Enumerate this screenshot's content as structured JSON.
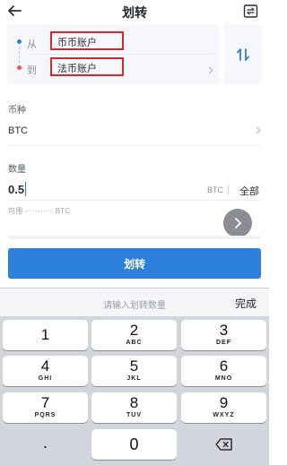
{
  "header": {
    "title": "划转",
    "back_icon": "arrow-left-icon",
    "record_icon": "transfer-record-icon"
  },
  "transfer": {
    "from_label": "从",
    "from_account": "币币账户",
    "to_label": "到",
    "to_account": "法币账户",
    "swap_icon": "swap-arrows-icon"
  },
  "coin": {
    "label": "币种",
    "value": "BTC"
  },
  "amount": {
    "label": "数量",
    "value": "0.5",
    "unit": "BTC",
    "all_label": "全部",
    "available_text": "可用 ··········· BTC"
  },
  "next_icon": "chevron-right-icon",
  "submit_label": "划转",
  "keyboard": {
    "placeholder": "请输入划转数量",
    "done_label": "完成",
    "keys": [
      {
        "num": "1",
        "letters": ""
      },
      {
        "num": "2",
        "letters": "ABC"
      },
      {
        "num": "3",
        "letters": "DEF"
      },
      {
        "num": "4",
        "letters": "GHI"
      },
      {
        "num": "5",
        "letters": "JKL"
      },
      {
        "num": "6",
        "letters": "MNO"
      },
      {
        "num": "7",
        "letters": "PQRS"
      },
      {
        "num": "8",
        "letters": "TUV"
      },
      {
        "num": "9",
        "letters": "WXYZ"
      }
    ],
    "dot": ".",
    "zero": "0",
    "delete_icon": "backspace-icon"
  },
  "colors": {
    "accent": "#2d80dc",
    "highlight_border": "#d9262c",
    "from_dot": "#2a7fd4",
    "to_dot": "#e8574a"
  }
}
